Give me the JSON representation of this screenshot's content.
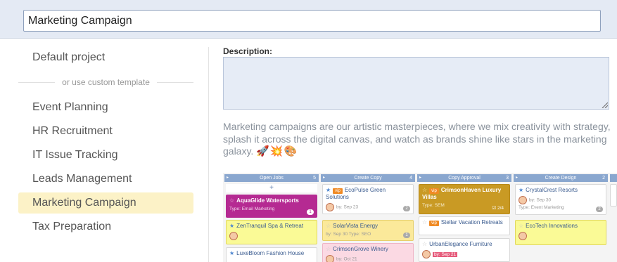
{
  "project_title": "Marketing Campaign",
  "templates": {
    "default_label": "Default project",
    "divider_label": "or use custom template",
    "items": [
      {
        "label": "Event Planning"
      },
      {
        "label": "HR Recruitment"
      },
      {
        "label": "IT Issue Tracking"
      },
      {
        "label": "Leads Management"
      },
      {
        "label": "Marketing Campaign",
        "selected": true
      },
      {
        "label": "Tax Preparation"
      }
    ]
  },
  "description": {
    "label": "Description:",
    "value": "",
    "template_text": "Marketing campaigns are our artistic masterpieces, where we mix creativity with strategy, splash it across the digital canvas, and watch as brands shine like stars in the marketing galaxy.",
    "emojis": "🚀💥🎨"
  },
  "preview": {
    "columns": [
      {
        "title": "Open Jobs",
        "count": "5",
        "add": "+",
        "cards": [
          {
            "star": "☆",
            "name": "AquaGlide Watersports",
            "meta": "Type: Email Marketing",
            "badge": "1"
          },
          {
            "star": "★",
            "name": "ZenTranquil Spa & Retreat",
            "meta": ""
          },
          {
            "star": "★",
            "name": "LuxeBloom Fashion House",
            "meta": ""
          }
        ]
      },
      {
        "title": "Create Copy",
        "count": "4",
        "cards": [
          {
            "star": "★",
            "vip": "vip",
            "name": "EcoPulse Green Solutions",
            "meta": "by: Sep 23",
            "badge": "2"
          },
          {
            "star": "☆",
            "name": "SolarVista Energy",
            "meta": "by: Sep 30   Type: SEO",
            "badge": "1"
          },
          {
            "star": "☆",
            "name": "CrimsonGrove Winery",
            "meta": "by: Oct 21"
          }
        ]
      },
      {
        "title": "Copy Approval",
        "count": "3",
        "cards": [
          {
            "star": "☆",
            "vip": "vip",
            "name": "CrimsonHaven Luxury Villas",
            "meta": "Type: SEM",
            "check": "2/4"
          },
          {
            "star": "☆",
            "vip": "vip",
            "name": "Stellar Vacation Retreats",
            "meta": ""
          },
          {
            "star": "☆",
            "name": "UrbanElegance Furniture",
            "meta": "by: Sep 21"
          }
        ]
      },
      {
        "title": "Create Design",
        "count": "2",
        "cards": [
          {
            "star": "★",
            "name": "CrystalCrest Resorts",
            "meta": "by: Sep 30",
            "meta2": "Type: Event Marketing",
            "badge": "2"
          },
          {
            "star": "☆",
            "name": "EcoTech Innovations",
            "meta": ""
          }
        ]
      }
    ]
  }
}
